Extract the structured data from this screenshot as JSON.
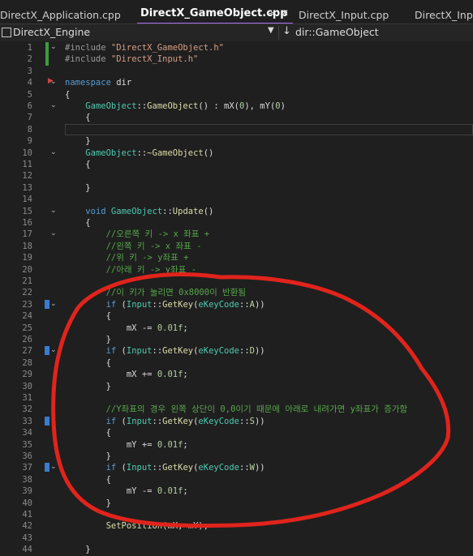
{
  "tabs": [
    {
      "label": "DirectX_Application.cpp",
      "active": false
    },
    {
      "label": "DirectX_GameObject.cpp",
      "active": true
    },
    {
      "label": "DirectX_Input.cpp",
      "active": false
    },
    {
      "label": "DirectX_Input",
      "active": false
    }
  ],
  "tab_pin_glyph": "⊸",
  "tab_close_glyph": "✕",
  "nav": {
    "project": "DirectX_Engine",
    "scope": "dir::GameObject"
  },
  "icons": {
    "project": "project-icon",
    "dropdown": "chevron-down-icon",
    "scope": "scope-arrow-icon",
    "fold": "fold-chevron-icon",
    "breakpoint": "bookmark-icon",
    "marker": "current-line-arrow-icon"
  },
  "colors": {
    "annotation": "#e0241c",
    "tab_accent": "#a86cf0",
    "change_bar": "#3f9b3f"
  },
  "lines": [
    {
      "n": "1",
      "text": "#include \"DirectX_GameObject.h\""
    },
    {
      "n": "2",
      "text": "#include \"DirectX_Input.h\""
    },
    {
      "n": "3",
      "text": ""
    },
    {
      "n": "4",
      "text": "namespace dir"
    },
    {
      "n": "5",
      "text": "{"
    },
    {
      "n": "6",
      "text": "    GameObject::GameObject() : mX(0), mY(0)"
    },
    {
      "n": "7",
      "text": "    {"
    },
    {
      "n": "8",
      "text": ""
    },
    {
      "n": "9",
      "text": "    }"
    },
    {
      "n": "10",
      "text": "    GameObject::~GameObject()"
    },
    {
      "n": "11",
      "text": "    {"
    },
    {
      "n": "12",
      "text": ""
    },
    {
      "n": "13",
      "text": "    }"
    },
    {
      "n": "14",
      "text": ""
    },
    {
      "n": "15",
      "text": "    void GameObject::Update()"
    },
    {
      "n": "16",
      "text": "    {"
    },
    {
      "n": "17",
      "text": "        //오른쪽 키 -> x 좌표 +"
    },
    {
      "n": "18",
      "text": "        //왼쪽 키 -> x 좌표 -"
    },
    {
      "n": "19",
      "text": "        //위 키 -> y좌표 +"
    },
    {
      "n": "20",
      "text": "        //아래 키 -> y좌표 -"
    },
    {
      "n": "21",
      "text": ""
    },
    {
      "n": "22",
      "text": "        //이 키가 눌리면 0x8000이 반환됨"
    },
    {
      "n": "23",
      "text": "        if (Input::GetKey(eKeyCode::A))"
    },
    {
      "n": "24",
      "text": "        {"
    },
    {
      "n": "25",
      "text": "            mX -= 0.01f;"
    },
    {
      "n": "26",
      "text": "        }"
    },
    {
      "n": "27",
      "text": "        if (Input::GetKey(eKeyCode::D))"
    },
    {
      "n": "28",
      "text": "        {"
    },
    {
      "n": "29",
      "text": "            mX += 0.01f;"
    },
    {
      "n": "30",
      "text": "        }"
    },
    {
      "n": "31",
      "text": ""
    },
    {
      "n": "32",
      "text": "        //Y좌표의 경우 왼쪽 상단이 0,0이기 때문에 아래로 내려가면 y좌표가 증가함"
    },
    {
      "n": "33",
      "text": "        if (Input::GetKey(eKeyCode::S))"
    },
    {
      "n": "34",
      "text": "        {"
    },
    {
      "n": "35",
      "text": "            mY += 0.01f;"
    },
    {
      "n": "36",
      "text": "        }"
    },
    {
      "n": "37",
      "text": "        if (Input::GetKey(eKeyCode::W))"
    },
    {
      "n": "38",
      "text": "        {"
    },
    {
      "n": "39",
      "text": "            mY -= 0.01f;"
    },
    {
      "n": "40",
      "text": "        }"
    },
    {
      "n": "41",
      "text": ""
    },
    {
      "n": "42",
      "text": "        SetPosition(mX, mY);"
    },
    {
      "n": "43",
      "text": ""
    },
    {
      "n": "44",
      "text": "    }"
    }
  ]
}
